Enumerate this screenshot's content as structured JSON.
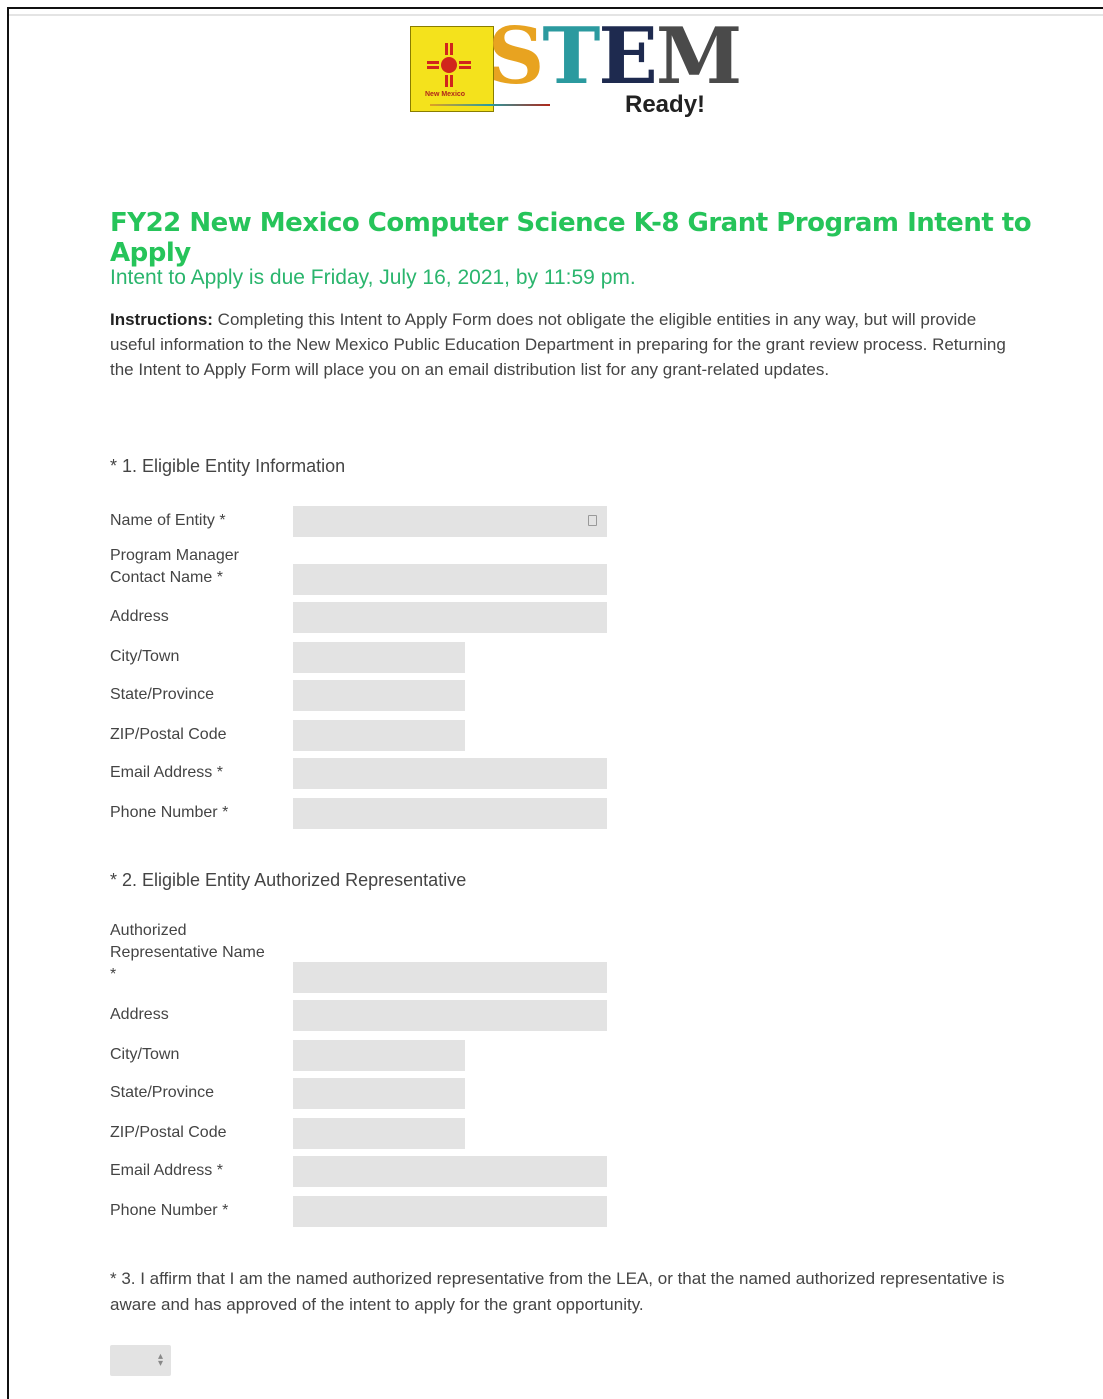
{
  "logo": {
    "state_label": "New Mexico",
    "word": "STEM",
    "sub": "Ready!"
  },
  "title": "FY22 New Mexico Computer Science K-8 Grant Program Intent to Apply",
  "due": "Intent to Apply is due Friday, July 16, 2021, by 11:59 pm.",
  "instructions": {
    "lead": "Instructions:",
    "body": " Completing this Intent to Apply Form does not obligate the eligible entities in any way, but will provide useful information to the New Mexico Public Education Department in preparing for the grant review process. Returning the Intent to Apply Form will place you on an email distribution list for any grant-related updates."
  },
  "section1": {
    "title": "* 1. Eligible Entity Information",
    "name_of_entity": "Name of Entity *",
    "program_manager": "Program Manager Contact Name *",
    "address": "Address",
    "city": "City/Town",
    "state": "State/Province",
    "zip": "ZIP/Postal Code",
    "email": "Email Address *",
    "phone": "Phone Number *"
  },
  "section2": {
    "title": "* 2. Eligible Entity Authorized Representative",
    "rep_name_line1": "Authorized",
    "rep_name_line2": "Representative Name",
    "rep_name_line3": "*",
    "address": "Address",
    "city": "City/Town",
    "state": "State/Province",
    "zip": "ZIP/Postal Code",
    "email": "Email Address *",
    "phone": "Phone Number *"
  },
  "section3": {
    "text": "* 3. I affirm that I am the named authorized representative from the LEA, or that the named authorized representative is aware and has approved of the intent to apply for the grant opportunity.",
    "select_value": ""
  },
  "colors": {
    "title_green": "#26c45a",
    "field_gray": "#e3e3e3"
  }
}
